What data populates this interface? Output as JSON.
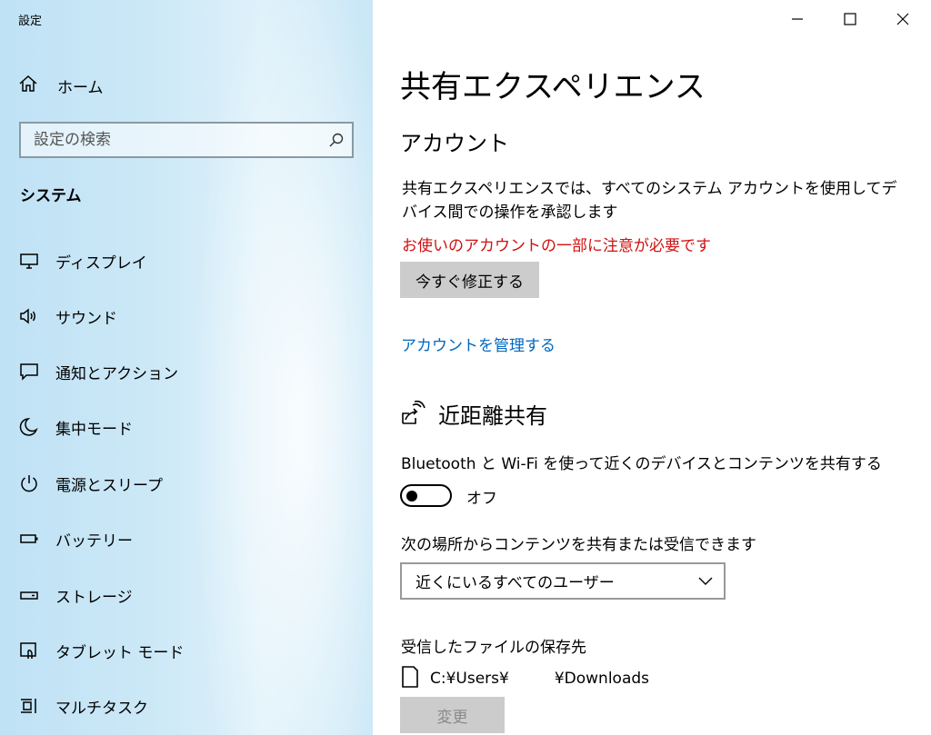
{
  "window": {
    "title": "設定",
    "controls": [
      "minimize",
      "maximize",
      "close"
    ]
  },
  "sidebar": {
    "home_label": "ホーム",
    "search_placeholder": "設定の検索",
    "section_title": "システム",
    "items": [
      {
        "label": "ディスプレイ",
        "icon": "monitor-icon"
      },
      {
        "label": "サウンド",
        "icon": "speaker-icon"
      },
      {
        "label": "通知とアクション",
        "icon": "notification-icon"
      },
      {
        "label": "集中モード",
        "icon": "moon-icon"
      },
      {
        "label": "電源とスリープ",
        "icon": "power-icon"
      },
      {
        "label": "バッテリー",
        "icon": "battery-icon"
      },
      {
        "label": "ストレージ",
        "icon": "storage-icon"
      },
      {
        "label": "タブレット モード",
        "icon": "tablet-icon"
      },
      {
        "label": "マルチタスク",
        "icon": "multitask-icon"
      }
    ]
  },
  "main": {
    "title": "共有エクスペリエンス",
    "account": {
      "heading": "アカウント",
      "description": "共有エクスペリエンスでは、すべてのシステム アカウントを使用してデバイス間での操作を承認します",
      "warning": "お使いのアカウントの一部に注意が必要です",
      "fix_button": "今すぐ修正する",
      "manage_link": "アカウントを管理する"
    },
    "nearby": {
      "heading": "近距離共有",
      "description": "Bluetooth と Wi-Fi を使って近くのデバイスとコンテンツを共有する",
      "toggle_state": "off",
      "toggle_label": "オフ",
      "share_receive_label": "次の場所からコンテンツを共有または受信できます",
      "share_receive_value": "近くにいるすべてのユーザー",
      "save_location_label": "受信したファイルの保存先",
      "save_path_part1": "C:¥Users¥",
      "save_path_part2": "¥Downloads",
      "change_button": "変更"
    }
  },
  "colors": {
    "warning": "#d11010",
    "link": "#0067c0",
    "button_bg": "#cccccc",
    "sidebar_tint": "#cce8f7"
  }
}
